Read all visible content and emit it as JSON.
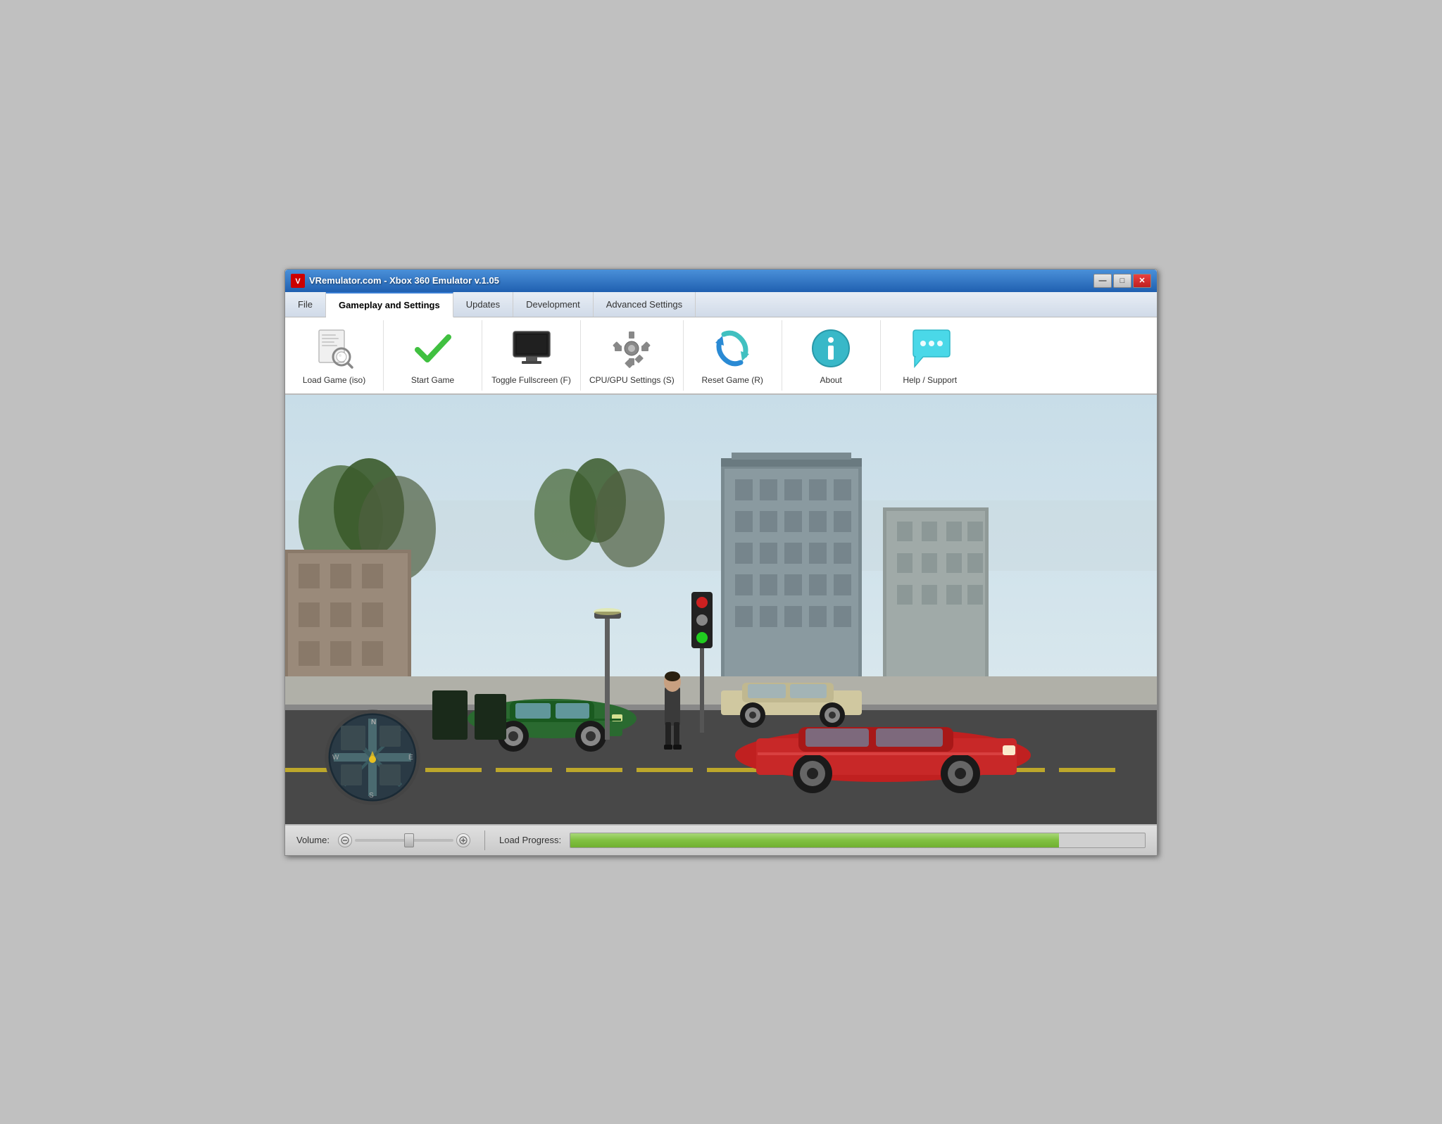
{
  "window": {
    "title": "VRemulator.com - Xbox 360 Emulator v.1.05",
    "icon_label": "V",
    "btn_min": "—",
    "btn_max": "□",
    "btn_close": "✕"
  },
  "menu": {
    "tabs": [
      {
        "id": "file",
        "label": "File",
        "active": false
      },
      {
        "id": "gameplay",
        "label": "Gameplay and Settings",
        "active": true
      },
      {
        "id": "updates",
        "label": "Updates",
        "active": false
      },
      {
        "id": "development",
        "label": "Development",
        "active": false
      },
      {
        "id": "advanced",
        "label": "Advanced Settings",
        "active": false
      }
    ]
  },
  "toolbar": {
    "items": [
      {
        "id": "load-game",
        "label": "Load Game (iso)"
      },
      {
        "id": "start-game",
        "label": "Start Game"
      },
      {
        "id": "toggle-fullscreen",
        "label": "Toggle Fullscreen (F)"
      },
      {
        "id": "cpu-gpu-settings",
        "label": "CPU/GPU Settings (S)"
      },
      {
        "id": "reset-game",
        "label": "Reset Game (R)"
      },
      {
        "id": "about",
        "label": "About"
      },
      {
        "id": "help-support",
        "label": "Help / Support"
      }
    ]
  },
  "status_bar": {
    "volume_label": "Volume:",
    "progress_label": "Load Progress:",
    "progress_percent": 85
  }
}
